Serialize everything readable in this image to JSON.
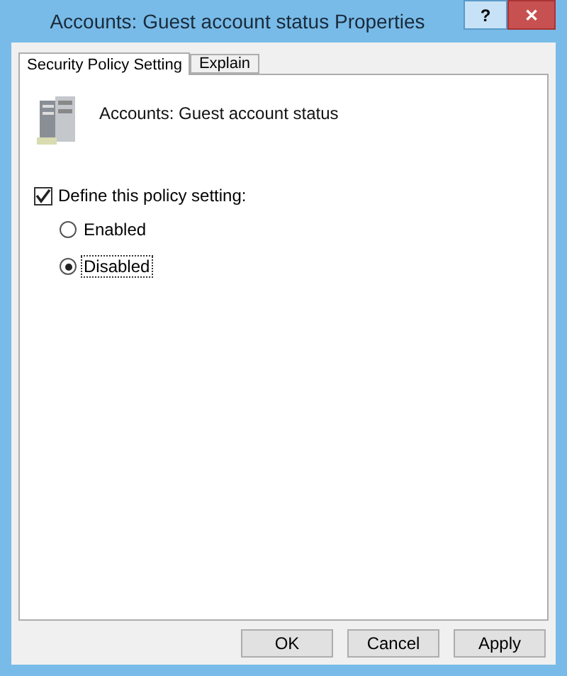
{
  "window": {
    "title": "Accounts: Guest account status Properties",
    "help": "?",
    "close": "✕"
  },
  "tabs": [
    {
      "label": "Security Policy Setting",
      "selected": true
    },
    {
      "label": "Explain",
      "selected": false
    }
  ],
  "policy": {
    "name": "Accounts: Guest account status"
  },
  "define": {
    "label": "Define this policy setting:",
    "checked": true
  },
  "options": [
    {
      "label": "Enabled",
      "selected": false,
      "focused": false
    },
    {
      "label": "Disabled",
      "selected": true,
      "focused": true
    }
  ],
  "buttons": [
    "OK",
    "Cancel",
    "Apply"
  ]
}
